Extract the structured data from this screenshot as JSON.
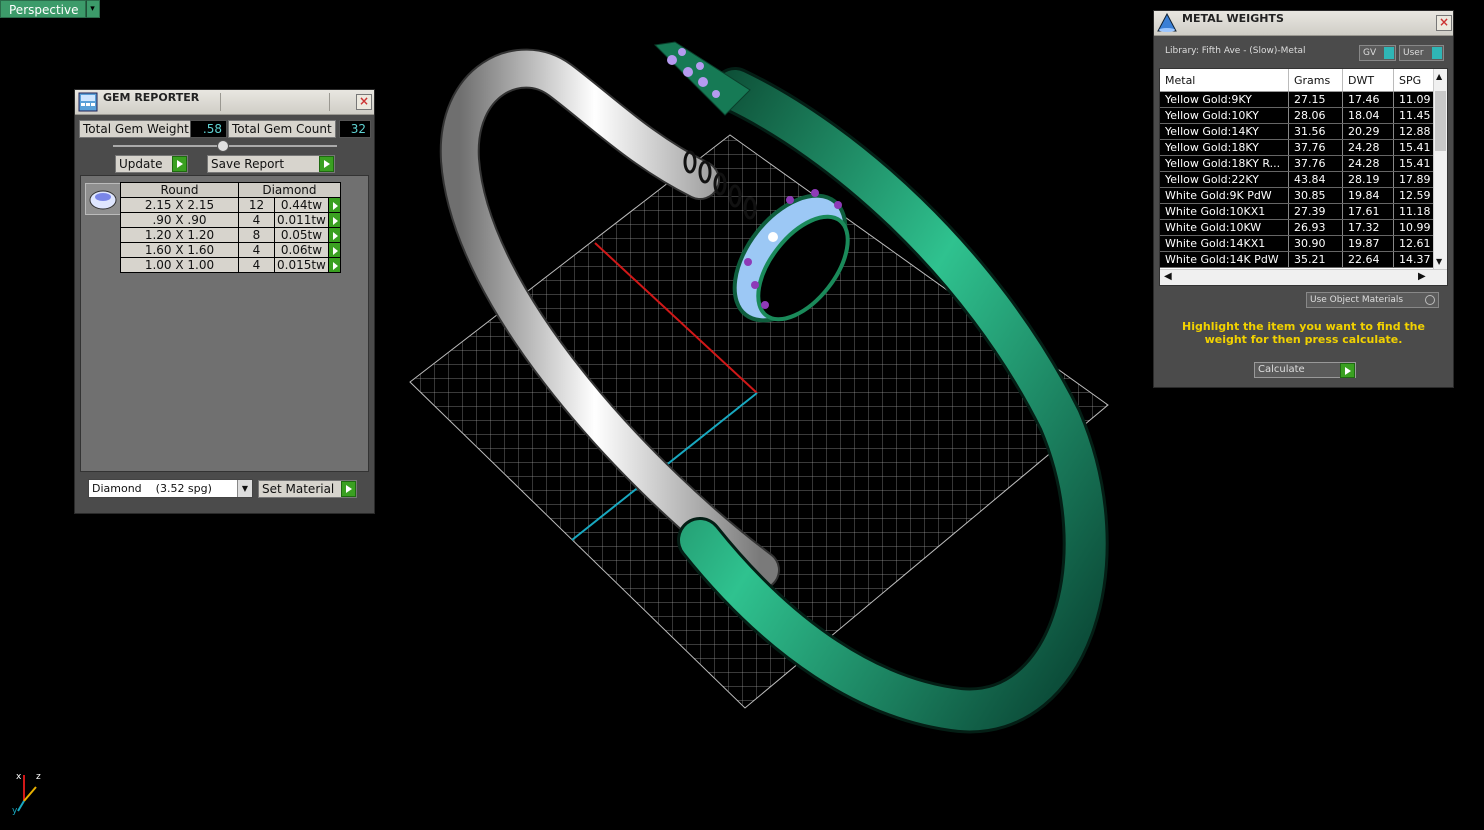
{
  "viewport": {
    "view_label": "Perspective"
  },
  "axis_indicator": {
    "x": "x",
    "y": "y",
    "z": "z"
  },
  "gem_reporter": {
    "title": "GEM REPORTER",
    "total_weight_label": "Total Gem Weight",
    "total_weight_value": ".58",
    "total_count_label": "Total Gem Count",
    "total_count_value": "32",
    "update_label": "Update",
    "save_report_label": "Save Report",
    "table_headers": [
      "Round",
      "Diamond"
    ],
    "rows": [
      {
        "size": "2.15 X 2.15",
        "count": "12",
        "weight": "0.44tw"
      },
      {
        "size": ".90 X .90",
        "count": "4",
        "weight": "0.011tw"
      },
      {
        "size": "1.20 X 1.20",
        "count": "8",
        "weight": "0.05tw"
      },
      {
        "size": "1.60 X 1.60",
        "count": "4",
        "weight": "0.06tw"
      },
      {
        "size": "1.00 X 1.00",
        "count": "4",
        "weight": "0.015tw"
      }
    ],
    "material_select": "Diamond    (3.52 spg)",
    "set_material_label": "Set Material"
  },
  "metal_weights": {
    "title": "METAL WEIGHTS",
    "library": "Library: Fifth Ave - (Slow)-Metal",
    "gv_label": "GV",
    "user_label": "User",
    "columns": [
      "Metal",
      "Grams",
      "DWT",
      "SPG"
    ],
    "rows": [
      {
        "metal": "Yellow Gold:9KY",
        "grams": "27.15",
        "dwt": "17.46",
        "spg": "11.09"
      },
      {
        "metal": "Yellow Gold:10KY",
        "grams": "28.06",
        "dwt": "18.04",
        "spg": "11.45"
      },
      {
        "metal": "Yellow Gold:14KY",
        "grams": "31.56",
        "dwt": "20.29",
        "spg": "12.88"
      },
      {
        "metal": "Yellow Gold:18KY",
        "grams": "37.76",
        "dwt": "24.28",
        "spg": "15.41"
      },
      {
        "metal": "Yellow Gold:18KY R...",
        "grams": "37.76",
        "dwt": "24.28",
        "spg": "15.41"
      },
      {
        "metal": "Yellow Gold:22KY",
        "grams": "43.84",
        "dwt": "28.19",
        "spg": "17.89"
      },
      {
        "metal": "White Gold:9K PdW",
        "grams": "30.85",
        "dwt": "19.84",
        "spg": "12.59"
      },
      {
        "metal": "White Gold:10KX1",
        "grams": "27.39",
        "dwt": "17.61",
        "spg": "11.18"
      },
      {
        "metal": "White Gold:10KW",
        "grams": "26.93",
        "dwt": "17.32",
        "spg": "10.99"
      },
      {
        "metal": "White Gold:14KX1",
        "grams": "30.90",
        "dwt": "19.87",
        "spg": "12.61"
      },
      {
        "metal": "White Gold:14K PdW",
        "grams": "35.21",
        "dwt": "22.64",
        "spg": "14.37"
      }
    ],
    "use_object_materials": "Use Object Materials",
    "hint": "Highlight the item you want to find the weight for then press calculate.",
    "calculate_label": "Calculate"
  }
}
